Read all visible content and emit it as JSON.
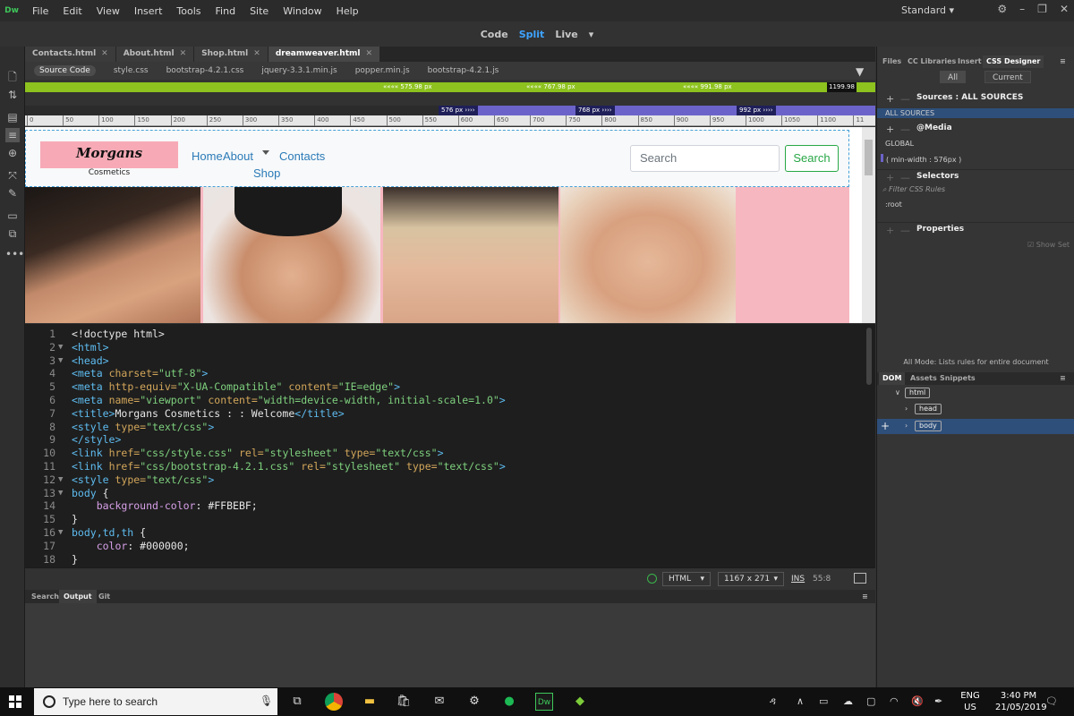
{
  "menubar": {
    "logo": "Dw",
    "items": [
      "File",
      "Edit",
      "View",
      "Insert",
      "Tools",
      "Find",
      "Site",
      "Window",
      "Help"
    ],
    "workspace": "Standard"
  },
  "views": {
    "code": "Code",
    "split": "Split",
    "live": "Live"
  },
  "doc_tabs": [
    {
      "label": "Contacts.html"
    },
    {
      "label": "About.html"
    },
    {
      "label": "Shop.html"
    },
    {
      "label": "dreamweaver.html",
      "active": true
    }
  ],
  "related_files": [
    "Source Code",
    "style.css",
    "bootstrap-4.2.1.css",
    "jquery-3.3.1.min.js",
    "popper.min.js",
    "bootstrap-4.2.1.js"
  ],
  "media_queries": {
    "max_width": [
      "575.98 px",
      "767.98 px",
      "991.98 px",
      "1199.98"
    ],
    "min_width": [
      "576 px",
      "768 px",
      "992 px"
    ]
  },
  "ruler_ticks": [
    "0",
    "50",
    "100",
    "150",
    "200",
    "250",
    "300",
    "350",
    "400",
    "450",
    "500",
    "550",
    "600",
    "650",
    "700",
    "750",
    "800",
    "850",
    "900",
    "950",
    "1000",
    "1050",
    "1100",
    "11"
  ],
  "site": {
    "logo_name": "Morgans",
    "logo_sub": "Cosmetics",
    "nav": {
      "home": "Home",
      "about": "About",
      "contacts": "Contacts",
      "shop": "Shop"
    },
    "search_placeholder": "Search",
    "search_button": "Search"
  },
  "code_lines": [
    {
      "n": "1",
      "fold": "",
      "html": "<span class=\"hx\">&lt;!doctype html&gt;</span>"
    },
    {
      "n": "2",
      "fold": "▼",
      "html": "<span class=\"tg\">&lt;html&gt;</span>"
    },
    {
      "n": "3",
      "fold": "▼",
      "html": "<span class=\"tg\">&lt;head&gt;</span>"
    },
    {
      "n": "4",
      "fold": "",
      "html": "<span class=\"tg\">&lt;meta</span> <span class=\"at\">charset=</span><span class=\"vl\">\"utf-8\"</span><span class=\"tg\">&gt;</span>"
    },
    {
      "n": "5",
      "fold": "",
      "html": "<span class=\"tg\">&lt;meta</span> <span class=\"at\">http-equiv=</span><span class=\"vl\">\"X-UA-Compatible\"</span> <span class=\"at\">content=</span><span class=\"vl\">\"IE=edge\"</span><span class=\"tg\">&gt;</span>"
    },
    {
      "n": "6",
      "fold": "",
      "html": "<span class=\"tg\">&lt;meta</span> <span class=\"at\">name=</span><span class=\"vl\">\"viewport\"</span> <span class=\"at\">content=</span><span class=\"vl\">\"width=device-width, initial-scale=1.0\"</span><span class=\"tg\">&gt;</span>"
    },
    {
      "n": "7",
      "fold": "",
      "html": "<span class=\"tg\">&lt;title&gt;</span>Morgans Cosmetics : : Welcome<span class=\"tg\">&lt;/title&gt;</span>"
    },
    {
      "n": "8",
      "fold": "",
      "html": "<span class=\"tg\">&lt;style</span> <span class=\"at\">type=</span><span class=\"vl\">\"text/css\"</span><span class=\"tg\">&gt;</span>"
    },
    {
      "n": "9",
      "fold": "",
      "html": "<span class=\"tg\">&lt;/style&gt;</span>"
    },
    {
      "n": "10",
      "fold": "",
      "html": "<span class=\"tg\">&lt;link</span> <span class=\"at\">href=</span><span class=\"vl\">\"css/style.css\"</span> <span class=\"at\">rel=</span><span class=\"vl\">\"stylesheet\"</span> <span class=\"at\">type=</span><span class=\"vl\">\"text/css\"</span><span class=\"tg\">&gt;</span>"
    },
    {
      "n": "11",
      "fold": "",
      "html": "<span class=\"tg\">&lt;link</span> <span class=\"at\">href=</span><span class=\"vl\">\"css/bootstrap-4.2.1.css\"</span> <span class=\"at\">rel=</span><span class=\"vl\">\"stylesheet\"</span> <span class=\"at\">type=</span><span class=\"vl\">\"text/css\"</span><span class=\"tg\">&gt;</span>"
    },
    {
      "n": "12",
      "fold": "▼",
      "html": "<span class=\"tg\">&lt;style</span> <span class=\"at\">type=</span><span class=\"vl\">\"text/css\"</span><span class=\"tg\">&gt;</span>"
    },
    {
      "n": "13",
      "fold": "▼",
      "html": "<span class=\"tg\">body</span> {"
    },
    {
      "n": "14",
      "fold": "",
      "html": "    <span class=\"pr\">background-color</span>: #FFBEBF;"
    },
    {
      "n": "15",
      "fold": "",
      "html": "}"
    },
    {
      "n": "16",
      "fold": "▼",
      "html": "<span class=\"tg\">body,td,th</span> {"
    },
    {
      "n": "17",
      "fold": "",
      "html": "    <span class=\"pr\">color</span>: #000000;"
    },
    {
      "n": "18",
      "fold": "",
      "html": "}"
    }
  ],
  "status": {
    "doc_type": "HTML",
    "size": "1167 x 271",
    "mode": "INS",
    "cursor": "55:8"
  },
  "output_tabs": [
    "Search",
    "Output",
    "Git"
  ],
  "right_panel": {
    "tabs": [
      "Files",
      "CC Libraries",
      "Insert",
      "CSS Designer"
    ],
    "modes": [
      "All",
      "Current"
    ],
    "sources_label": "Sources :",
    "sources_value": "ALL SOURCES",
    "sources_item": "ALL SOURCES",
    "media_label": "@Media",
    "media_global": "GLOBAL",
    "media_query": "( min-width : 576px )",
    "selectors_label": "Selectors",
    "filter_placeholder": "Filter CSS Rules",
    "selector_item": ":root",
    "properties_label": "Properties",
    "show_set": "Show Set",
    "mode_note": "All Mode: Lists rules for entire document",
    "dom_tabs": [
      "DOM",
      "Assets",
      "Snippets"
    ],
    "dom_nodes": [
      "html",
      "head",
      "body"
    ]
  },
  "taskbar": {
    "search_placeholder": "Type here to search",
    "lang_top": "ENG",
    "lang_bottom": "US",
    "time": "3:40 PM",
    "date": "21/05/2019"
  },
  "colors": {
    "accent": "#3ea3ff",
    "green_bar": "#8dc21f",
    "purple_bar": "#6b63c9",
    "page_bg": "#FFBEBF",
    "bootstrap_green": "#28a745"
  }
}
